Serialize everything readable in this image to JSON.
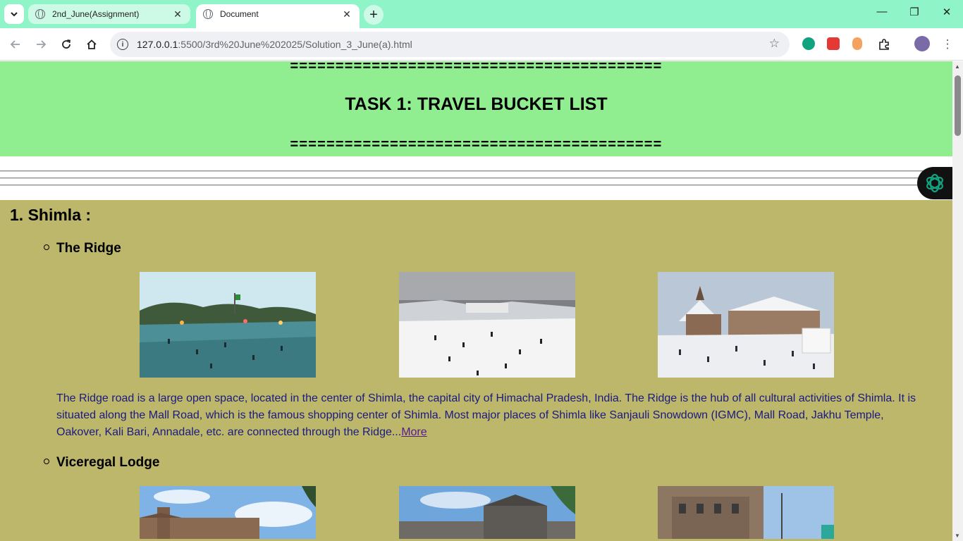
{
  "browser": {
    "tabs": [
      {
        "title": "2nd_June(Assignment)",
        "active": false
      },
      {
        "title": "Document",
        "active": true
      }
    ],
    "address": {
      "host": "127.0.0.1",
      "path": ":5500/3rd%20June%202025/Solution_3_June(a).html"
    },
    "accent_color": "#8ff5c8"
  },
  "page": {
    "header": {
      "divider_text": "=========================================",
      "title": "TASK 1: TRAVEL BUCKET LIST",
      "background": "#90ee90"
    },
    "section": {
      "heading": "1. Shimla :",
      "background": "#bdb76b",
      "places": [
        {
          "name": "The Ridge",
          "photos": [
            "ridge-lights-photo",
            "ridge-snow-crowd-photo",
            "ridge-church-snow-photo"
          ],
          "description": "The Ridge road is a large open space, located in the center of Shimla, the capital city of Himachal Pradesh, India. The Ridge is the hub of all cultural activities of Shimla. It is situated along the Mall Road, which is the famous shopping center of Shimla. Most major places of Shimla like Sanjauli Snowdown (IGMC), Mall Road, Jakhu Temple, Oakover, Kali Bari, Annadale, etc. are connected through the Ridge...",
          "more_link": "More"
        },
        {
          "name": "Viceregal Lodge",
          "photos": [
            "lodge-front-photo",
            "lodge-facade-photo",
            "lodge-tower-photo"
          ]
        }
      ]
    }
  }
}
